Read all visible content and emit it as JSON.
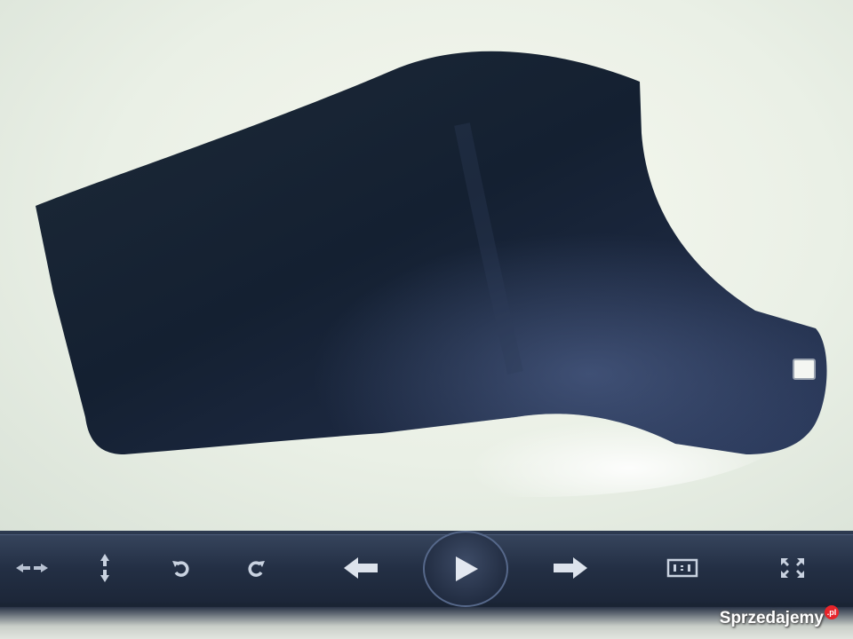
{
  "viewer": {
    "watermark_text": "Sprzedajemy",
    "watermark_suffix": ".pl"
  },
  "toolbar": {
    "buttons": [
      {
        "name": "fit-width-button",
        "icon": "fit-width-icon"
      },
      {
        "name": "fit-height-button",
        "icon": "fit-height-icon"
      },
      {
        "name": "rotate-left-button",
        "icon": "rotate-left-icon"
      },
      {
        "name": "rotate-right-button",
        "icon": "rotate-right-icon"
      },
      {
        "name": "previous-button",
        "icon": "arrow-left-icon"
      },
      {
        "name": "play-button",
        "icon": "play-icon"
      },
      {
        "name": "next-button",
        "icon": "arrow-right-icon"
      },
      {
        "name": "actual-size-button",
        "icon": "actual-size-icon"
      },
      {
        "name": "fullscreen-button",
        "icon": "fullscreen-icon"
      }
    ]
  },
  "colors": {
    "toolbar_bg": "#232f44",
    "icon": "#c9d2e0",
    "object": "#1a2436",
    "watermark_badge": "#e8242a"
  }
}
